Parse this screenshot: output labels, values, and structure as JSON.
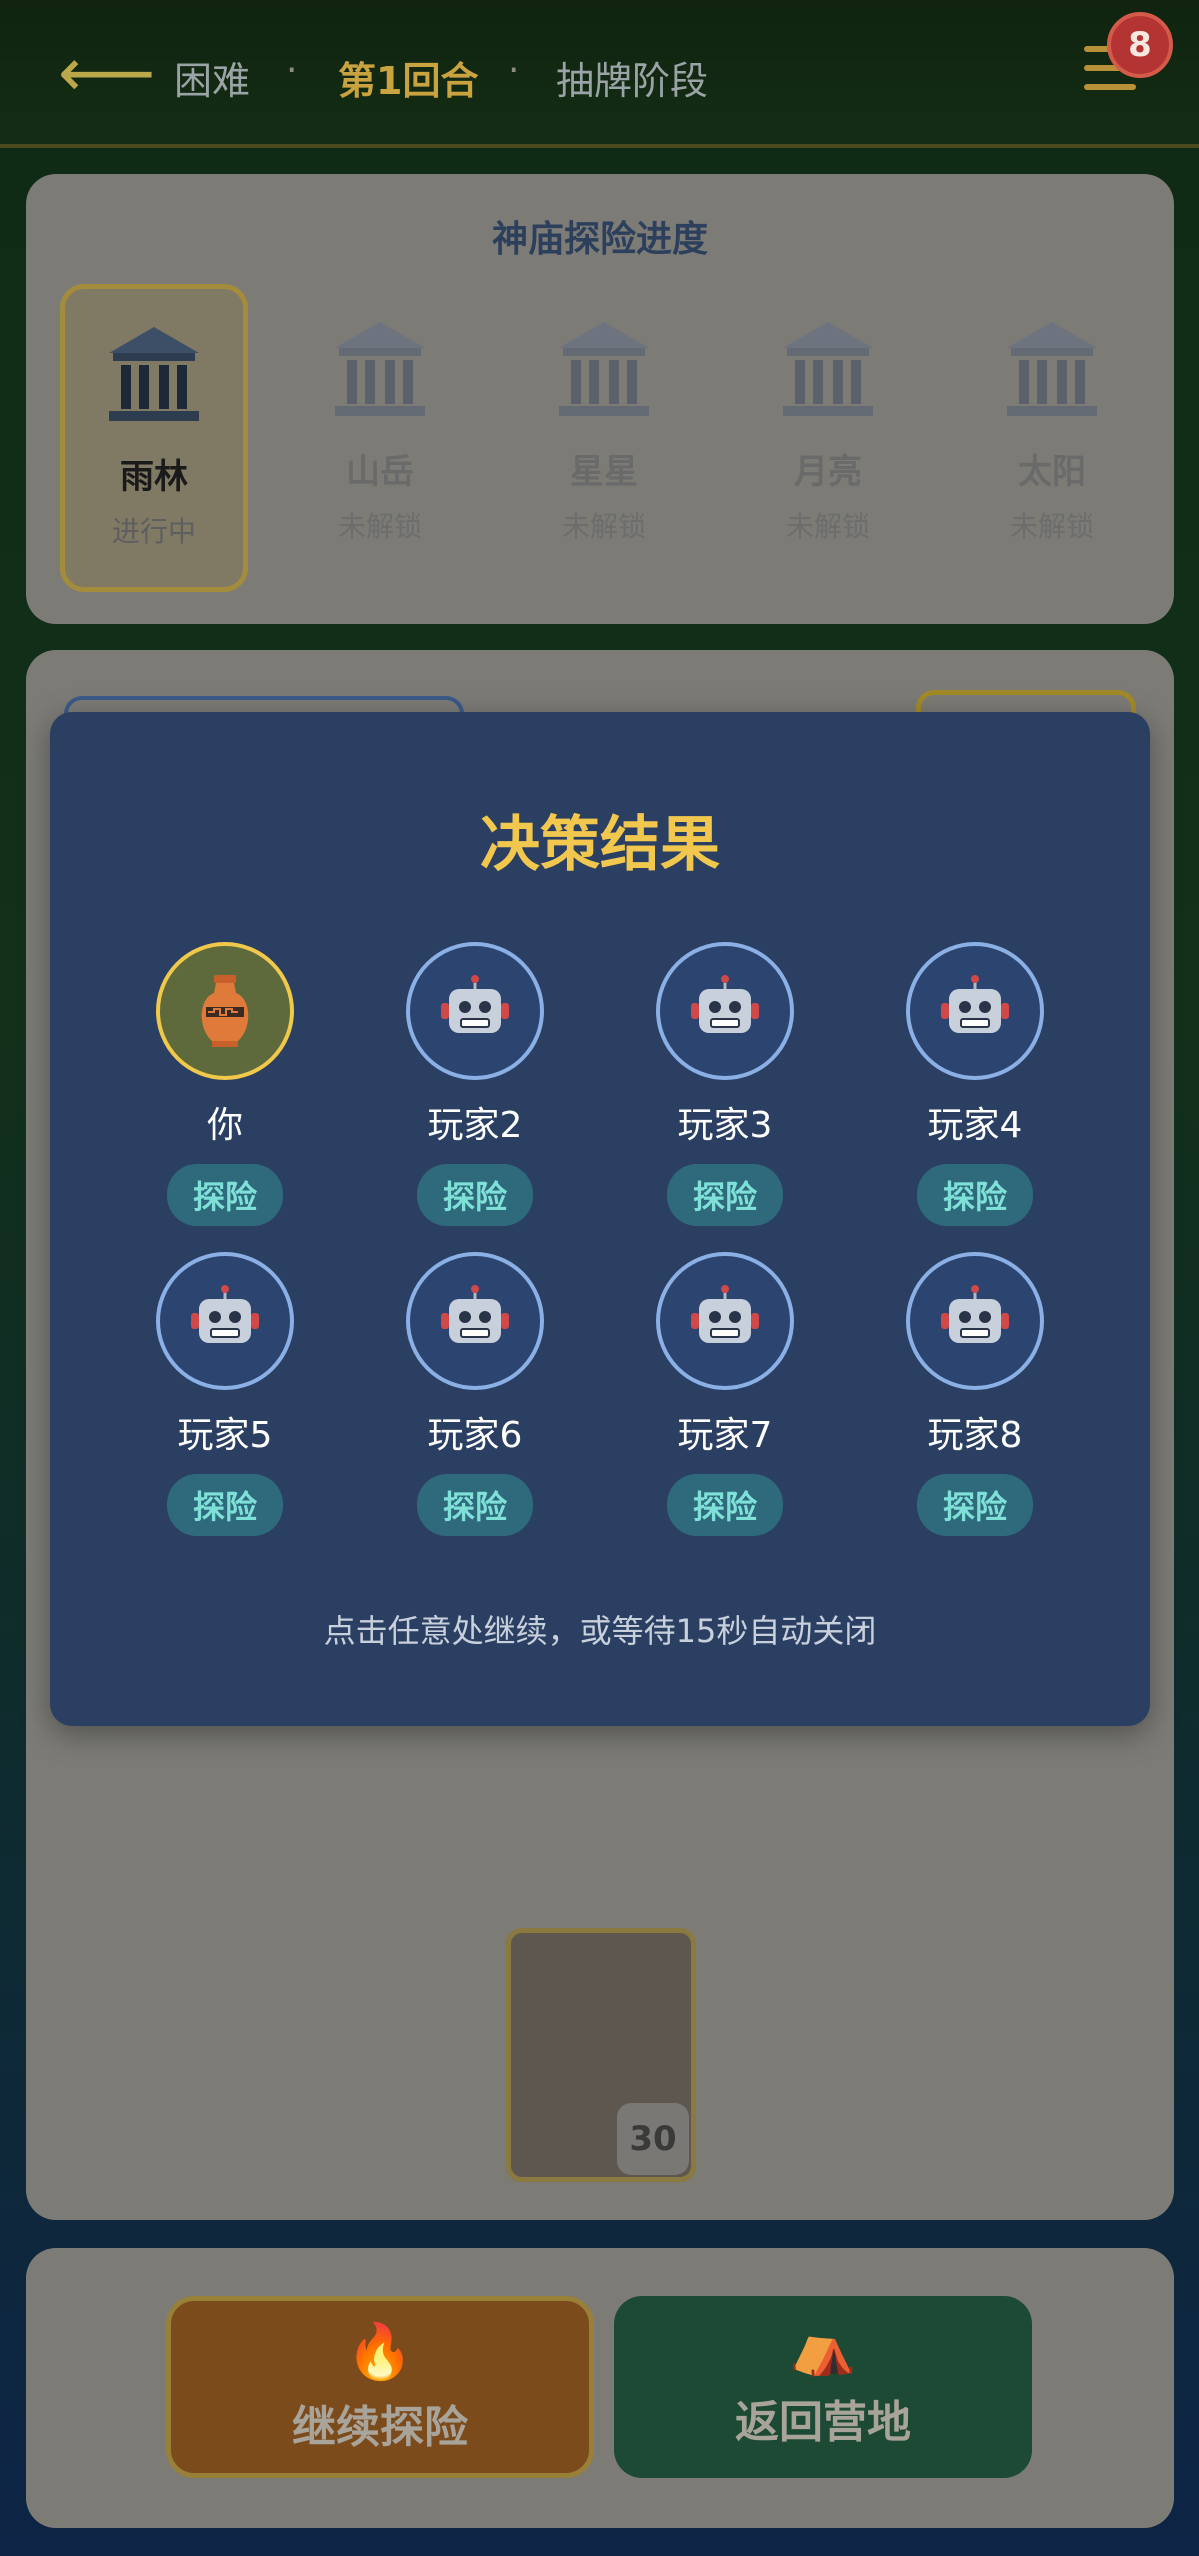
{
  "header": {
    "difficulty": "困难",
    "round": "第1回合",
    "phase": "抽牌阶段",
    "separator": "·",
    "badge_count": "8"
  },
  "progress": {
    "title": "神庙探险进度",
    "temples": [
      {
        "name": "雨林",
        "status": "进行中"
      },
      {
        "name": "山岳",
        "status": "未解锁"
      },
      {
        "name": "星星",
        "status": "未解锁"
      },
      {
        "name": "月亮",
        "status": "未解锁"
      },
      {
        "name": "太阳",
        "status": "未解锁"
      }
    ]
  },
  "board": {
    "deck_count": "30"
  },
  "actions": {
    "continue_label": "继续探险",
    "return_label": "返回营地"
  },
  "modal": {
    "title": "决策结果",
    "players": [
      {
        "name": "你",
        "decision": "探险"
      },
      {
        "name": "玩家2",
        "decision": "探险"
      },
      {
        "name": "玩家3",
        "decision": "探险"
      },
      {
        "name": "玩家4",
        "decision": "探险"
      },
      {
        "name": "玩家5",
        "decision": "探险"
      },
      {
        "name": "玩家6",
        "decision": "探险"
      },
      {
        "name": "玩家7",
        "decision": "探险"
      },
      {
        "name": "玩家8",
        "decision": "探险"
      }
    ],
    "hint": "点击任意处继续，或等待15秒自动关闭"
  }
}
